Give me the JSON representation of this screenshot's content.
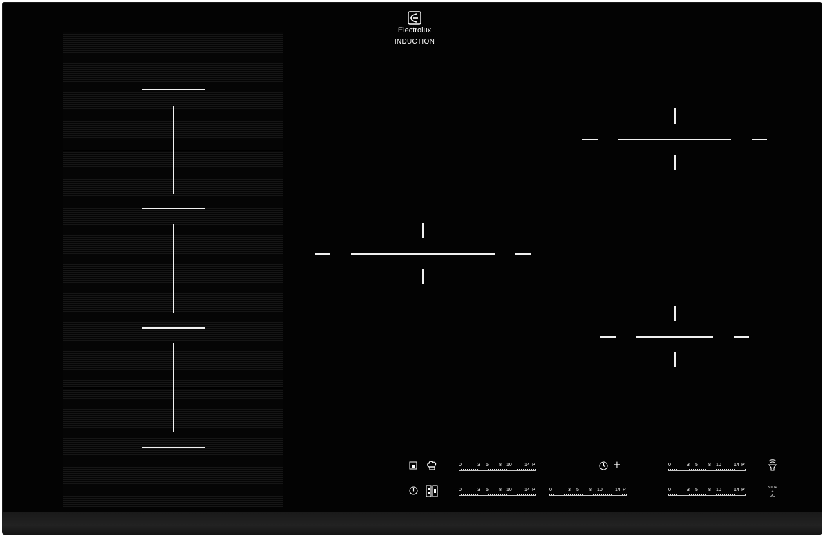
{
  "brand": {
    "name": "Electrolux",
    "subtitle": "INDUCTION",
    "logo_icon": "electrolux-logo-icon"
  },
  "power_scale": {
    "labels": [
      "0",
      "3",
      "5",
      "8",
      "10",
      "14",
      "P"
    ]
  },
  "controls": {
    "timer_minus": "–",
    "timer_plus": "+",
    "timer_icon": "clock-icon",
    "stop_go_line1": "STOP",
    "stop_go_line2": "+",
    "stop_go_line3": "GO",
    "icons": [
      "lock-icon",
      "chef-hat-icon",
      "power-icon",
      "flex-bridge-icon",
      "clock-icon",
      "hob2hood-icon"
    ]
  },
  "colors": {
    "glass": "#030303",
    "markings": "#f0f0f0"
  }
}
